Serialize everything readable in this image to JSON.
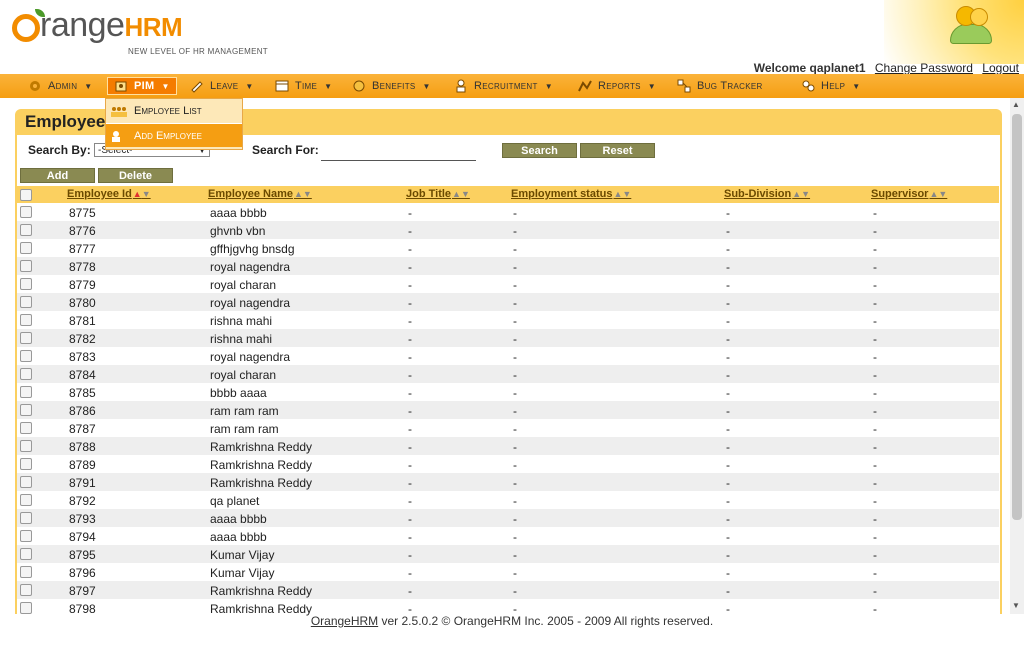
{
  "header": {
    "logo_brand_main": "range",
    "logo_brand_hrm": "HRM",
    "logo_tagline": "NEW LEVEL OF HR MANAGEMENT",
    "welcome_text": "Welcome qaplanet1",
    "change_password": "Change Password",
    "logout": "Logout"
  },
  "menu": [
    {
      "label": "Admin",
      "icon": "admin-icon"
    },
    {
      "label": "PIM",
      "icon": "pim-icon",
      "active": true
    },
    {
      "label": "Leave",
      "icon": "leave-icon"
    },
    {
      "label": "Time",
      "icon": "time-icon"
    },
    {
      "label": "Benefits",
      "icon": "benefits-icon"
    },
    {
      "label": "Recruitment",
      "icon": "recruitment-icon"
    },
    {
      "label": "Reports",
      "icon": "reports-icon"
    },
    {
      "label": "Bug Tracker",
      "icon": "bug-tracker-icon"
    },
    {
      "label": "Help",
      "icon": "help-icon"
    }
  ],
  "pim_dropdown": [
    {
      "label": "Employee List",
      "icon": "employee-list-icon"
    },
    {
      "label": "Add Employee",
      "icon": "add-employee-icon",
      "highlighted": true
    }
  ],
  "page_title": "Employee",
  "search": {
    "by_label": "Search By:",
    "by_value": "-Select-",
    "for_label": "Search For:",
    "for_value": "",
    "search_button": "Search",
    "reset_button": "Reset"
  },
  "actions": {
    "add": "Add",
    "delete": "Delete"
  },
  "columns": [
    "Employee Id",
    "Employee Name",
    "Job Title",
    "Employment status",
    "Sub-Division",
    "Supervisor"
  ],
  "rows": [
    [
      "8775",
      "aaaa bbbb",
      "-",
      "-",
      "-",
      "-"
    ],
    [
      "8776",
      "ghvnb vbn",
      "-",
      "-",
      "-",
      "-"
    ],
    [
      "8777",
      "gffhjgvhg bnsdg",
      "-",
      "-",
      "-",
      "-"
    ],
    [
      "8778",
      "royal nagendra",
      "-",
      "-",
      "-",
      "-"
    ],
    [
      "8779",
      "royal charan",
      "-",
      "-",
      "-",
      "-"
    ],
    [
      "8780",
      "royal nagendra",
      "-",
      "-",
      "-",
      "-"
    ],
    [
      "8781",
      "rishna mahi",
      "-",
      "-",
      "-",
      "-"
    ],
    [
      "8782",
      "rishna mahi",
      "-",
      "-",
      "-",
      "-"
    ],
    [
      "8783",
      "royal nagendra",
      "-",
      "-",
      "-",
      "-"
    ],
    [
      "8784",
      "royal charan",
      "-",
      "-",
      "-",
      "-"
    ],
    [
      "8785",
      "bbbb aaaa",
      "-",
      "-",
      "-",
      "-"
    ],
    [
      "8786",
      "ram ram ram",
      "-",
      "-",
      "-",
      "-"
    ],
    [
      "8787",
      "ram ram ram",
      "-",
      "-",
      "-",
      "-"
    ],
    [
      "8788",
      "Ramkrishna Reddy",
      "-",
      "-",
      "-",
      "-"
    ],
    [
      "8789",
      "Ramkrishna Reddy",
      "-",
      "-",
      "-",
      "-"
    ],
    [
      "8791",
      "Ramkrishna Reddy",
      "-",
      "-",
      "-",
      "-"
    ],
    [
      "8792",
      "qa planet",
      "-",
      "-",
      "-",
      "-"
    ],
    [
      "8793",
      "aaaa bbbb",
      "-",
      "-",
      "-",
      "-"
    ],
    [
      "8794",
      "aaaa bbbb",
      "-",
      "-",
      "-",
      "-"
    ],
    [
      "8795",
      "Kumar Vijay",
      "-",
      "-",
      "-",
      "-"
    ],
    [
      "8796",
      "Kumar Vijay",
      "-",
      "-",
      "-",
      "-"
    ],
    [
      "8797",
      "Ramkrishna Reddy",
      "-",
      "-",
      "-",
      "-"
    ],
    [
      "8798",
      "Ramkrishna Reddy",
      "-",
      "-",
      "-",
      "-"
    ]
  ],
  "footer": {
    "link": "OrangeHRM",
    "text": " ver 2.5.0.2 © OrangeHRM Inc. 2005 - 2009 All rights reserved."
  },
  "colors": {
    "accent": "#f59e12",
    "panel": "#fbd060",
    "button": "#8a8a52"
  }
}
